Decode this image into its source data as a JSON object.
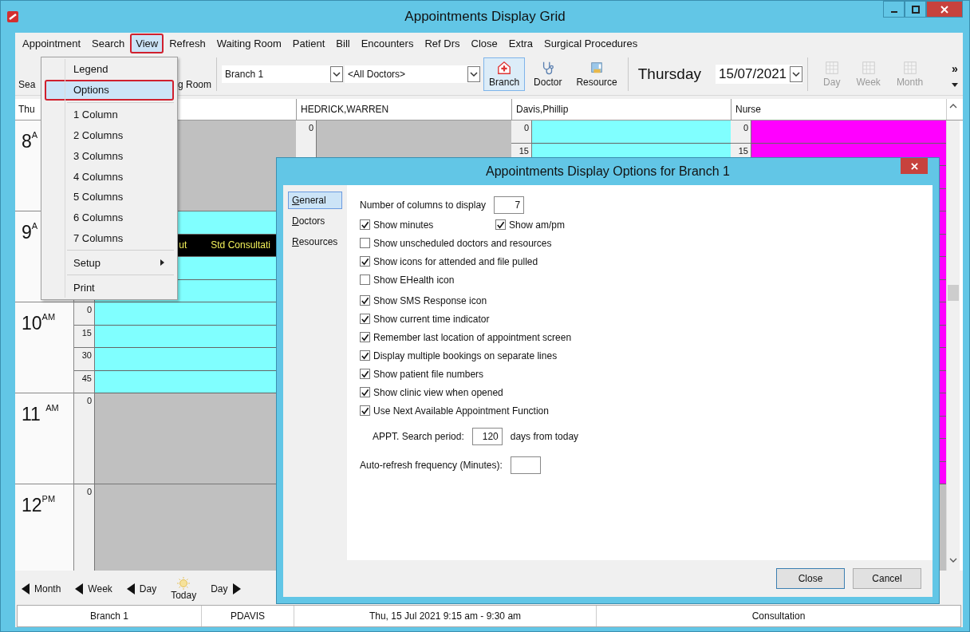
{
  "window": {
    "title": "Appointments Display Grid"
  },
  "menu_bar": [
    {
      "label": "Appointment",
      "selected": false,
      "marked": false
    },
    {
      "label": "Search",
      "selected": false,
      "marked": false
    },
    {
      "label": "View",
      "selected": true,
      "marked": true
    },
    {
      "label": "Refresh",
      "selected": false,
      "marked": false
    },
    {
      "label": "Waiting Room",
      "selected": false,
      "marked": false
    },
    {
      "label": "Patient",
      "selected": false,
      "marked": false
    },
    {
      "label": "Bill",
      "selected": false,
      "marked": false
    },
    {
      "label": "Encounters",
      "selected": false,
      "marked": false
    },
    {
      "label": "Ref Drs",
      "selected": false,
      "marked": false
    },
    {
      "label": "Close",
      "selected": false,
      "marked": false
    },
    {
      "label": "Extra",
      "selected": false,
      "marked": false
    },
    {
      "label": "Surgical Procedures",
      "selected": false,
      "marked": false
    }
  ],
  "toolbar": {
    "search": "Sea",
    "waiting_room": "g Room",
    "branch_combo": "Branch 1",
    "doctor_combo": "<All Doctors>",
    "buttons": [
      {
        "label": "Branch",
        "selected": true,
        "kind": "branch"
      },
      {
        "label": "Doctor",
        "selected": false,
        "kind": "doctor"
      },
      {
        "label": "Resource",
        "selected": false,
        "kind": "resource"
      }
    ],
    "day_name": "Thursday",
    "date": "15/07/2021",
    "views": [
      {
        "label": "Day",
        "disabled": true
      },
      {
        "label": "Week",
        "disabled": true
      },
      {
        "label": "Month",
        "disabled": true
      }
    ],
    "overflow": "»"
  },
  "view_menu": [
    {
      "kind": "item",
      "label": "Legend",
      "selected": false,
      "marked": false
    },
    {
      "kind": "item",
      "label": "Options",
      "selected": true,
      "marked": true
    },
    {
      "kind": "separator"
    },
    {
      "kind": "item",
      "label": "1 Column",
      "selected": false,
      "marked": false
    },
    {
      "kind": "item",
      "label": "2 Columns",
      "selected": false,
      "marked": false
    },
    {
      "kind": "item",
      "label": "3 Columns",
      "selected": false,
      "marked": false
    },
    {
      "kind": "item",
      "label": "4 Columns",
      "selected": false,
      "marked": false
    },
    {
      "kind": "item",
      "label": "5 Columns",
      "selected": false,
      "marked": false
    },
    {
      "kind": "item",
      "label": "6 Columns",
      "selected": false,
      "marked": false
    },
    {
      "kind": "item",
      "label": "7 Columns",
      "selected": false,
      "marked": false
    },
    {
      "kind": "separator"
    },
    {
      "kind": "submenu",
      "label": "Setup",
      "selected": false,
      "marked": false
    },
    {
      "kind": "separator"
    },
    {
      "kind": "item",
      "label": "Print",
      "selected": false,
      "marked": false
    }
  ],
  "grid": {
    "corner": "Thu",
    "hours": [
      {
        "label": "8$^{A}$"
      },
      {
        "label": "9$^{A}$"
      },
      {
        "label": "10$^{AM}$"
      },
      {
        "label": "11 $^{AM}$"
      },
      {
        "label": "12$^{PM}$"
      }
    ],
    "columns": [
      {
        "color": "#80ffff",
        "blocks": [
          {
            "kind": "closed"
          },
          {
            "kind": "open",
            "slots": [
              {
                "kind": "free"
              },
              {
                "kind": "booked",
                "texts": [
                  "ut",
                  "Std Consultati"
                ]
              },
              {
                "kind": "free"
              },
              {
                "kind": "free"
              }
            ]
          },
          {
            "kind": "open",
            "slots": [
              {
                "kind": "free",
                "minute": "0"
              },
              {
                "kind": "free",
                "minute": "15"
              },
              {
                "kind": "free",
                "minute": "30"
              },
              {
                "kind": "free",
                "minute": "45"
              }
            ]
          },
          {
            "kind": "closed",
            "minute": "0"
          },
          {
            "kind": "closed",
            "minute": "0"
          }
        ]
      },
      {
        "name": "HEDRICK,WARREN",
        "blocks": [
          {
            "kind": "closed",
            "minute": "0"
          }
        ]
      },
      {
        "name": "Davis,Phillip",
        "color": "#80ffff",
        "blocks": [
          {
            "kind": "open",
            "slots": [
              {
                "kind": "free",
                "minute": "0"
              },
              {
                "kind": "free",
                "minute": "15"
              }
            ]
          }
        ]
      },
      {
        "name": "Nurse",
        "color": "#ff00ff",
        "blocks": [
          {
            "kind": "open",
            "slots": [
              {
                "kind": "free",
                "minute": "0"
              },
              {
                "kind": "free",
                "minute": "15"
              },
              {
                "kind": "free"
              },
              {
                "kind": "free"
              }
            ]
          },
          {
            "kind": "open",
            "slots": [
              {
                "kind": "free"
              },
              {
                "kind": "free"
              },
              {
                "kind": "free"
              },
              {
                "kind": "free"
              }
            ]
          },
          {
            "kind": "open",
            "slots": [
              {
                "kind": "free"
              },
              {
                "kind": "free"
              },
              {
                "kind": "free"
              },
              {
                "kind": "free"
              }
            ]
          },
          {
            "kind": "open",
            "slots": [
              {
                "kind": "free"
              },
              {
                "kind": "free"
              },
              {
                "kind": "free"
              },
              {
                "kind": "free"
              }
            ]
          },
          {
            "kind": "closed"
          }
        ]
      }
    ]
  },
  "nav_bar": [
    {
      "label": "Month",
      "kind": "back"
    },
    {
      "label": "Week",
      "kind": "back"
    },
    {
      "label": "Day",
      "kind": "back"
    },
    {
      "label": "Today",
      "kind": "today"
    },
    {
      "label": "Day",
      "kind": "forward"
    }
  ],
  "status_bar": [
    "Branch 1",
    "PDAVIS",
    "Thu, 15 Jul 2021 9:15 am - 9:30 am",
    "Consultation"
  ],
  "dialog": {
    "title": "Appointments Display Options for Branch 1",
    "nav": [
      {
        "label": "General",
        "selected": true
      },
      {
        "label": "Doctors",
        "selected": false
      },
      {
        "label": "Resources",
        "selected": false
      }
    ],
    "columns_field": {
      "label": "Number of columns to display",
      "value": "7"
    },
    "option_rows": [
      [
        {
          "label": "Show minutes",
          "checked": true
        },
        {
          "label": "Show am/pm",
          "checked": true
        }
      ],
      [
        {
          "label": "Show unscheduled doctors and resources",
          "checked": false
        }
      ],
      [
        {
          "label": "Show icons for attended and file pulled",
          "checked": true
        }
      ],
      [
        {
          "label": "Show EHealth icon",
          "checked": false
        }
      ],
      [
        {
          "label": "Show SMS Response icon",
          "checked": true
        }
      ],
      [
        {
          "label": "Show current time indicator",
          "checked": true
        }
      ],
      [
        {
          "label": "Remember last location of appointment screen",
          "checked": true
        }
      ],
      [
        {
          "label": "Display multiple bookings on separate lines",
          "checked": true
        }
      ],
      [
        {
          "label": "Show patient file numbers",
          "checked": true
        }
      ],
      [
        {
          "label": "Show clinic view when opened",
          "checked": true
        }
      ],
      [
        {
          "label": "Use Next Available Appointment Function",
          "checked": true
        }
      ]
    ],
    "search_period": {
      "label": "APPT. Search period:",
      "value": "120",
      "suffix": "days from today"
    },
    "auto_refresh": {
      "label": "Auto-refresh frequency (Minutes):"
    },
    "buttons": [
      {
        "label": "Close",
        "default": true
      },
      {
        "label": "Cancel",
        "default": false
      }
    ]
  }
}
